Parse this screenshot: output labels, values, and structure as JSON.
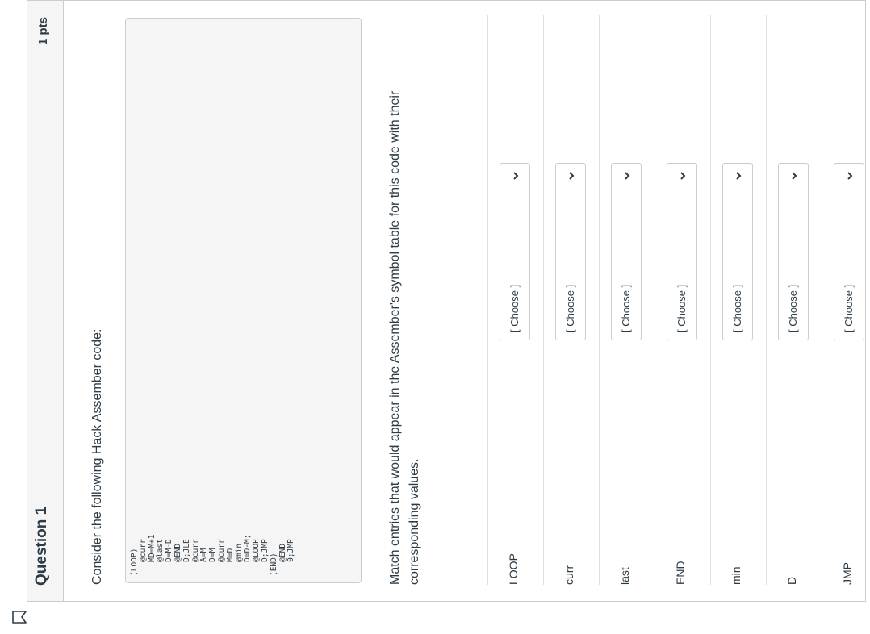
{
  "question": {
    "title": "Question 1",
    "points": "1 pts",
    "intro": "Consider the following Hack Assember code:",
    "code": "(LOOP)\n   @curr\n   MD=M+1\n   @last\n   D=M-D\n   @END\n   D;JLE\n   @curr\n   A=M\n   D=M\n   @curr\n   M=D\n   @min\n   D=D-M;\n   @LOOP\n   D;JMP\n(END)\n   @END\n   0;JMP",
    "instructions": "Match entries that would appear in the Assember's symbol table for this code with their corresponding values."
  },
  "matches": [
    {
      "label": "LOOP",
      "selected": "[ Choose ]"
    },
    {
      "label": "curr",
      "selected": "[ Choose ]"
    },
    {
      "label": "last",
      "selected": "[ Choose ]"
    },
    {
      "label": "END",
      "selected": "[ Choose ]"
    },
    {
      "label": "min",
      "selected": "[ Choose ]"
    },
    {
      "label": "D",
      "selected": "[ Choose ]"
    },
    {
      "label": "JMP",
      "selected": "[ Choose ]"
    }
  ],
  "icons": {
    "flag": "bookmark-flag-icon",
    "dropdown": "chevron-down-icon"
  },
  "colors": {
    "text": "#2d3b45",
    "border": "#c7cdd1",
    "header_bg": "#f5f5f5",
    "flag": "#2d3b45"
  }
}
